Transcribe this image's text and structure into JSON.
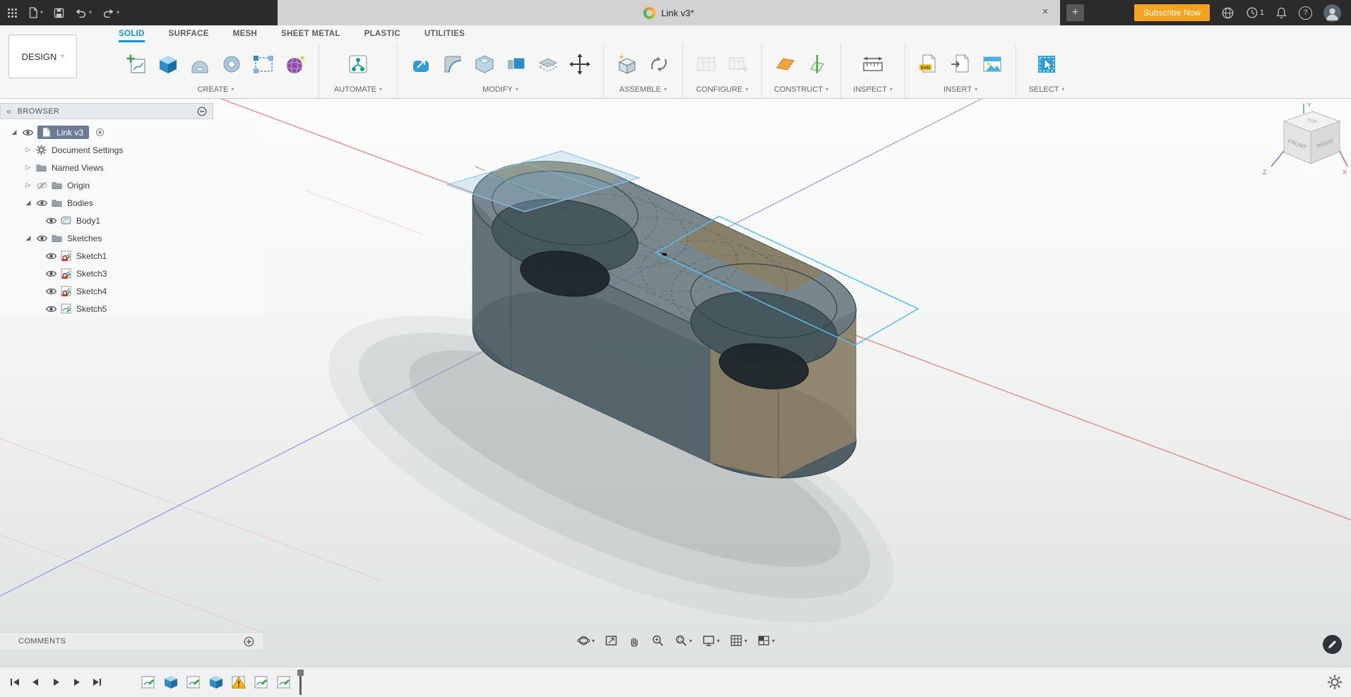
{
  "ui": {
    "caret": "▾",
    "collapsed_arrow": "▷",
    "expanded_arrow": "◢",
    "double_chevron_left": "«",
    "close": "×"
  },
  "titlebar": {
    "document_tab": {
      "title": "Link v3*"
    },
    "new_tab": "+",
    "subscribe_label": "Subscribe Now",
    "job_badge": "1",
    "help_label": "?",
    "left_icons": [
      "app-grid",
      "file-menu",
      "save",
      "undo",
      "redo"
    ],
    "right_icons": [
      "globe",
      "job-status",
      "notifications",
      "help",
      "avatar"
    ]
  },
  "ribbon": {
    "workspace_selector": "DESIGN",
    "tabs": [
      {
        "label": "SOLID",
        "active": true
      },
      {
        "label": "SURFACE",
        "active": false
      },
      {
        "label": "MESH",
        "active": false
      },
      {
        "label": "SHEET METAL",
        "active": false
      },
      {
        "label": "PLASTIC",
        "active": false
      },
      {
        "label": "UTILITIES",
        "active": false
      }
    ],
    "groups": [
      {
        "label": "CREATE",
        "icons": [
          "create-sketch",
          "box",
          "extrude",
          "torus",
          "rectangular-pattern",
          "create-form"
        ]
      },
      {
        "label": "AUTOMATE",
        "icons": [
          "automated-modeling"
        ]
      },
      {
        "label": "MODIFY",
        "icons": [
          "press-pull",
          "fillet",
          "shell",
          "combine",
          "offset-face",
          "move-copy"
        ]
      },
      {
        "label": "ASSEMBLE",
        "icons": [
          "new-component",
          "joint"
        ]
      },
      {
        "label": "CONFIGURE",
        "icons": [
          "configuration-table",
          "insert-configuration"
        ],
        "disabled": true
      },
      {
        "label": "CONSTRUCT",
        "icons": [
          "offset-plane",
          "axis"
        ]
      },
      {
        "label": "INSPECT",
        "icons": [
          "measure"
        ]
      },
      {
        "label": "INSERT",
        "icons": [
          "insert-svg",
          "insert-mesh",
          "canvas"
        ]
      },
      {
        "label": "SELECT",
        "icons": [
          "select"
        ]
      }
    ],
    "svg_badge": "SVG"
  },
  "browser": {
    "header": "BROWSER",
    "rows": [
      {
        "label": "Link v3",
        "level": 0,
        "selected": true
      },
      {
        "label": "Document Settings",
        "level": 1
      },
      {
        "label": "Named Views",
        "level": 1
      },
      {
        "label": "Origin",
        "level": 1,
        "hidden": true
      },
      {
        "label": "Bodies",
        "level": 1
      },
      {
        "label": "Body1",
        "level": 2
      },
      {
        "label": "Sketches",
        "level": 1
      },
      {
        "label": "Sketch1",
        "level": 2
      },
      {
        "label": "Sketch3",
        "level": 2
      },
      {
        "label": "Sketch4",
        "level": 2
      },
      {
        "label": "Sketch5",
        "level": 2
      }
    ]
  },
  "viewport": {
    "viewcube": {
      "front": "FRONT",
      "right": "RIGHT",
      "top": "TOP",
      "axis_x": "X",
      "axis_y": "Y",
      "axis_z": "Z"
    }
  },
  "comments": {
    "label": "COMMENTS"
  },
  "navbar": {
    "items": [
      "orbit",
      "look-at",
      "pan",
      "zoom",
      "zoom-window",
      "display-settings",
      "grid-and-snaps",
      "viewports"
    ]
  },
  "timeline": {
    "playback": [
      "go-to-start",
      "step-back",
      "play",
      "step-forward",
      "go-to-end"
    ],
    "features": [
      "sketch",
      "extrude",
      "sketch",
      "extrude",
      "sketch-warning",
      "sketch",
      "sketch"
    ]
  }
}
